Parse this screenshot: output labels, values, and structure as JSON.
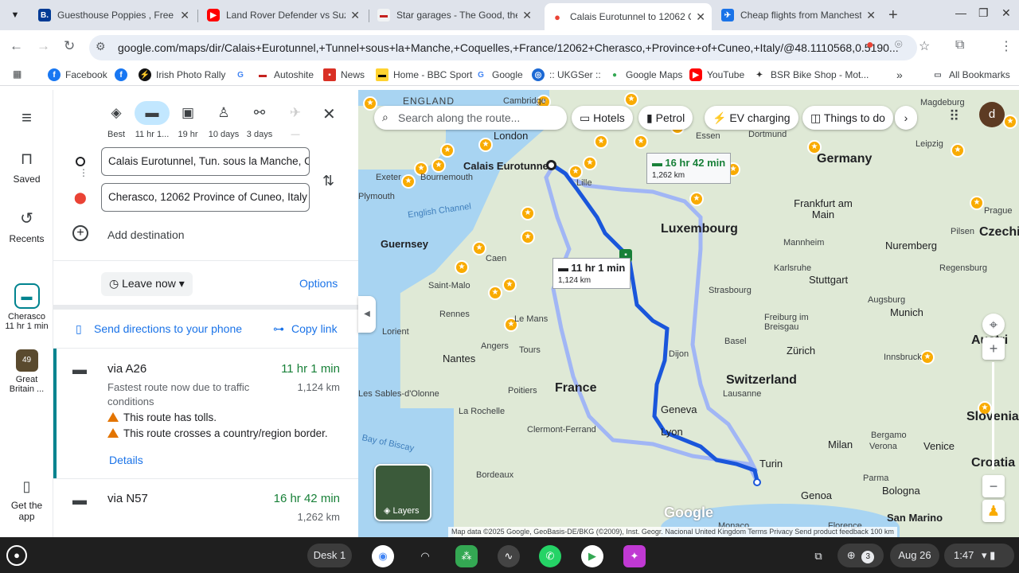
{
  "browser": {
    "tabs": [
      {
        "title": "Guesthouse Poppies , Free Pa",
        "icon": "booking-icon",
        "color": "#003b95",
        "letter": "B."
      },
      {
        "title": "Land Rover Defender vs Suzu",
        "icon": "youtube-icon",
        "color": "#ff0000",
        "letter": "▶"
      },
      {
        "title": "Star garages - The Good, the",
        "icon": "car-icon",
        "color": "#c5221f",
        "letter": "🚗"
      },
      {
        "title": "Calais Eurotunnel to 12062 C",
        "icon": "maps-pin-icon",
        "color": "#ea4335",
        "letter": "📍"
      },
      {
        "title": "Cheap flights from Manchest",
        "icon": "flights-icon",
        "color": "#1a73e8",
        "letter": "✈"
      }
    ],
    "url": "google.com/maps/dir/Calais+Eurotunnel,+Tunnel+sous+la+Manche,+Coquelles,+France/12062+Cherasco,+Province+of+Cuneo,+Italy/@48.1110568,0.5190...",
    "bookmarks": [
      {
        "label": "Facebook",
        "icon": "facebook-icon",
        "color": "#1877f2"
      },
      {
        "label": "",
        "icon": "facebook-icon",
        "color": "#1877f2"
      },
      {
        "label": "Irish Photo Rally",
        "icon": "rally-icon",
        "color": "#111111"
      },
      {
        "label": "",
        "icon": "google-icon",
        "color": "#4285f4"
      },
      {
        "label": "Autoshite",
        "icon": "car-icon",
        "color": "#c5221f"
      },
      {
        "label": "News",
        "icon": "news-icon",
        "color": "#d93025"
      },
      {
        "label": "Home - BBC Sport",
        "icon": "bbc-icon",
        "color": "#ffd230"
      },
      {
        "label": "Google",
        "icon": "google-icon",
        "color": "#4285f4"
      },
      {
        "label": ":: UKGSer ::",
        "icon": "bmw-icon",
        "color": "#1c69d4"
      },
      {
        "label": "Google Maps",
        "icon": "maps-pin-icon",
        "color": "#34a853"
      },
      {
        "label": "YouTube",
        "icon": "youtube-icon",
        "color": "#ff0000"
      },
      {
        "label": "BSR Bike Shop - Mot...",
        "icon": "bike-shop-icon",
        "color": "#333333"
      }
    ],
    "all_bookmarks": "All Bookmarks"
  },
  "rail": {
    "menu_icon": "menu-icon",
    "items": [
      {
        "label": "Saved",
        "icon": "bookmark-icon"
      },
      {
        "label": "Recents",
        "icon": "history-icon"
      },
      {
        "label": "Cherasco",
        "sub": "11 hr 1 min",
        "icon": "car-icon"
      },
      {
        "label": "Great",
        "sub": "Britain ...",
        "icon": "photo-icon",
        "badge": "49"
      }
    ],
    "get_app": "Get the app"
  },
  "modes": [
    {
      "label": "Best",
      "icon": "best-route-icon"
    },
    {
      "label": "11 hr 1...",
      "icon": "car-icon",
      "selected": true
    },
    {
      "label": "19 hr",
      "icon": "train-icon"
    },
    {
      "label": "10 days",
      "icon": "walk-icon"
    },
    {
      "label": "3 days",
      "icon": "bike-icon"
    },
    {
      "label": "—",
      "icon": "flight-icon"
    }
  ],
  "directions": {
    "origin": "Calais Eurotunnel, Tun. sous la Manche, Coquelles",
    "destination": "Cherasco, 12062 Province of Cuneo, Italy",
    "add_destination": "Add destination",
    "leave_now": "Leave now",
    "options": "Options",
    "send_to_phone": "Send directions to your phone",
    "copy_link": "Copy link"
  },
  "routes": [
    {
      "via": "via A26",
      "time": "11 hr 1 min",
      "distance": "1,124 km",
      "desc": "Fastest route now due to traffic conditions",
      "warnings": [
        "This route has tolls.",
        "This route crosses a country/region border."
      ],
      "details": "Details"
    },
    {
      "via": "via N57",
      "time": "16 hr 42 min",
      "distance": "1,262 km"
    }
  ],
  "map": {
    "search_placeholder": "Search along the route...",
    "chips": [
      "Hotels",
      "Petrol",
      "EV charging",
      "Things to do"
    ],
    "route_labels": [
      {
        "time": "11 hr 1 min",
        "dist": "1,124 km"
      },
      {
        "time": "16 hr 42 min",
        "dist": "1,262 km"
      }
    ],
    "countries": [
      "ENGLAND",
      "Germany",
      "France",
      "Switzerland",
      "Luxembourg",
      "Czechi",
      "Austri",
      "Slovenia",
      "Croatia",
      "San Marino"
    ],
    "cities": [
      "London",
      "Calais Eurotunnel",
      "Exeter",
      "Bournemouth",
      "Plymouth",
      "English Channel",
      "Guernsey",
      "Caen",
      "Saint-Malo",
      "Le Mans",
      "Rennes",
      "Lorient",
      "Angers",
      "Tours",
      "Nantes",
      "Poitiers",
      "La Rochelle",
      "Les Sables-d'Olonne",
      "Bordeaux",
      "Clermont-Ferrand",
      "Lyon",
      "Geneva",
      "Lausanne",
      "Dijon",
      "Strasbourg",
      "Stuttgart",
      "Munich",
      "Zürich",
      "Frankfurt am Main",
      "Dortmund",
      "Essen",
      "Leipzig",
      "Prague",
      "Nuremberg",
      "Mannheim",
      "Karlsruhe",
      "Freiburg im Breisgau",
      "Basel",
      "Milan",
      "Turin",
      "Genoa",
      "Bergamo",
      "Verona",
      "Venice",
      "Parma",
      "Bologna",
      "Florence",
      "Monaco",
      "Regensburg",
      "Augsburg",
      "Innsbruck",
      "Pilsen",
      "Magdeburg",
      "Lille",
      "Bay of Biscay",
      "Cambridge"
    ],
    "layers": "Layers",
    "attribution": "Map data ©2025 Google, GeoBasis-DE/BKG (©2009), Inst. Geogr. Nacional   United Kingdom   Terms   Privacy   Send product feedback   100 km",
    "google_logo": "Google"
  },
  "taskbar": {
    "desk": "Desk 1",
    "date": "Aug 26",
    "time": "1:47",
    "notif_count": "3"
  }
}
